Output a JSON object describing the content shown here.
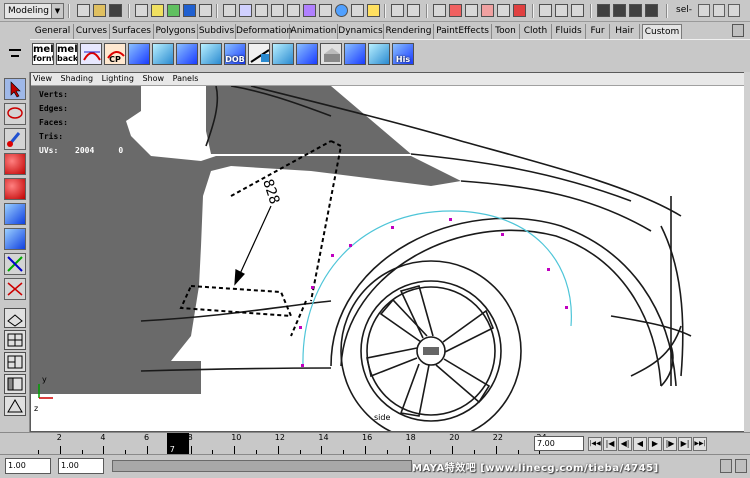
{
  "statusline": {
    "mode": "Modeling",
    "selection_label": "sel-"
  },
  "shelf_tabs": [
    {
      "label": "General"
    },
    {
      "label": "Curves"
    },
    {
      "label": "Surfaces"
    },
    {
      "label": "Polygons"
    },
    {
      "label": "Subdivs"
    },
    {
      "label": "Deformation"
    },
    {
      "label": "Animation"
    },
    {
      "label": "Dynamics"
    },
    {
      "label": "Rendering"
    },
    {
      "label": "PaintEffects"
    },
    {
      "label": "Toon"
    },
    {
      "label": "Cloth"
    },
    {
      "label": "Fluids"
    },
    {
      "label": "Fur"
    },
    {
      "label": "Hair"
    },
    {
      "label": "Custom"
    }
  ],
  "active_shelf_tab": "Custom",
  "shelf_buttons": {
    "mel_front_1": "mel",
    "mel_front_2": "fornt",
    "mel_back_1": "mel",
    "mel_back_2": "back",
    "cp_label": "CP",
    "dob_label": "DOB",
    "his_label": "His"
  },
  "viewport": {
    "menus": [
      "View",
      "Shading",
      "Lighting",
      "Show",
      "Panels"
    ],
    "hud": {
      "verts": "Verts:",
      "edges": "Edges:",
      "faces": "Faces:",
      "tris": "Tris:",
      "uvs": "UVs:",
      "uvs_values": "2004     0       0"
    },
    "drawing_label": "828",
    "view_name": "side",
    "axis_x": "z",
    "axis_y": "y"
  },
  "timeslider": {
    "ticks": [
      "2",
      "4",
      "6",
      "8",
      "10",
      "12",
      "14",
      "16",
      "18",
      "20",
      "22",
      "24"
    ],
    "current_frame": "7",
    "current_time_value": "7.00",
    "range_start": "1.00",
    "range_end": "1.00"
  },
  "playback_buttons": [
    {
      "name": "go-to-start-button",
      "glyph": "|◀◀"
    },
    {
      "name": "step-back-key-button",
      "glyph": "|◀"
    },
    {
      "name": "step-back-frame-button",
      "glyph": "◀|"
    },
    {
      "name": "play-backward-button",
      "glyph": "◀"
    },
    {
      "name": "play-forward-button",
      "glyph": "▶"
    },
    {
      "name": "step-forward-frame-button",
      "glyph": "|▶"
    },
    {
      "name": "step-forward-key-button",
      "glyph": "▶|"
    },
    {
      "name": "go-to-end-button",
      "glyph": "▶▶|"
    }
  ],
  "watermark": "MAYA特效吧  [www.linecg.com/tieba/4745]",
  "colors": {
    "ui_gray": "#c8c8c8",
    "dark_gray_fill": "#6a6a6a",
    "selection_cyan": "#4ec5d8",
    "control_point": "#c000c0",
    "axis_green": "#00a000",
    "axis_red": "#d00000"
  }
}
